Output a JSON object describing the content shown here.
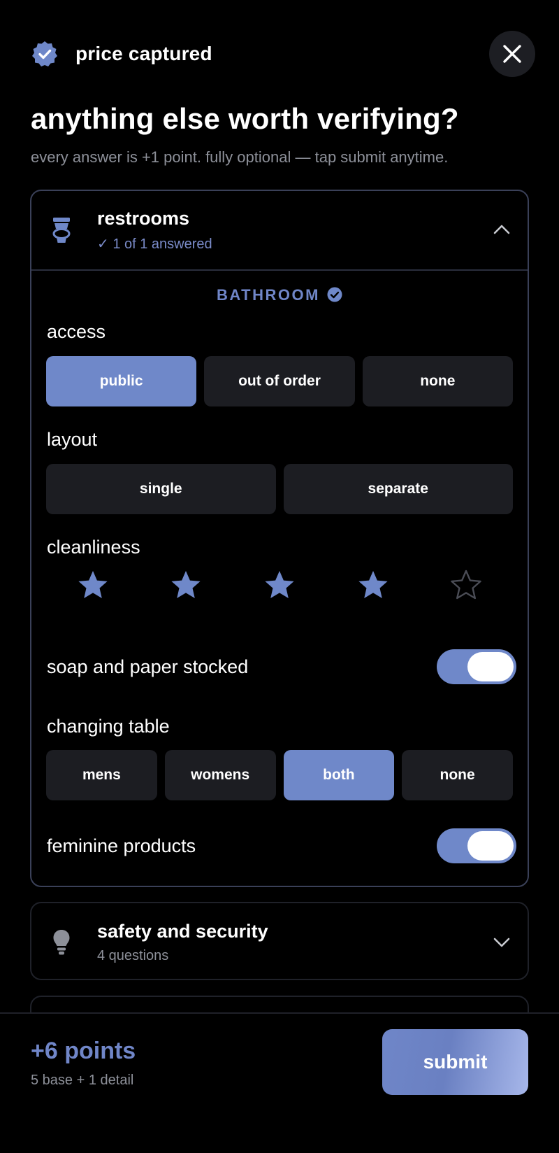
{
  "header": {
    "title": "price captured",
    "close_icon": "close-icon",
    "badge_icon": "verified-badge-icon"
  },
  "headline": "anything else worth verifying?",
  "subline": "every answer is +1 point. fully optional — tap submit anytime.",
  "colors": {
    "accent": "#6f88c9",
    "accent_text": "#7086c8",
    "chip_bg": "#1c1d22"
  },
  "restrooms": {
    "title": "restrooms",
    "status": "✓ 1 of 1 answered",
    "icon": "toilet-icon",
    "section_tag": "BATHROOM",
    "access": {
      "label": "access",
      "options": [
        "public",
        "out of order",
        "none"
      ],
      "selected": "public"
    },
    "layout": {
      "label": "layout",
      "options": [
        "single",
        "separate"
      ],
      "selected": null
    },
    "cleanliness": {
      "label": "cleanliness",
      "rating": 4,
      "max": 5
    },
    "soap": {
      "label": "soap and paper stocked",
      "on": true
    },
    "changing_table": {
      "label": "changing table",
      "options": [
        "mens",
        "womens",
        "both",
        "none"
      ],
      "selected": "both"
    },
    "feminine": {
      "label": "feminine products",
      "on": true
    }
  },
  "safety": {
    "title": "safety and security",
    "status": "4 questions",
    "icon": "lightbulb-icon"
  },
  "footer": {
    "points": "+6 points",
    "breakdown": "5 base + 1 detail",
    "submit_label": "submit"
  }
}
